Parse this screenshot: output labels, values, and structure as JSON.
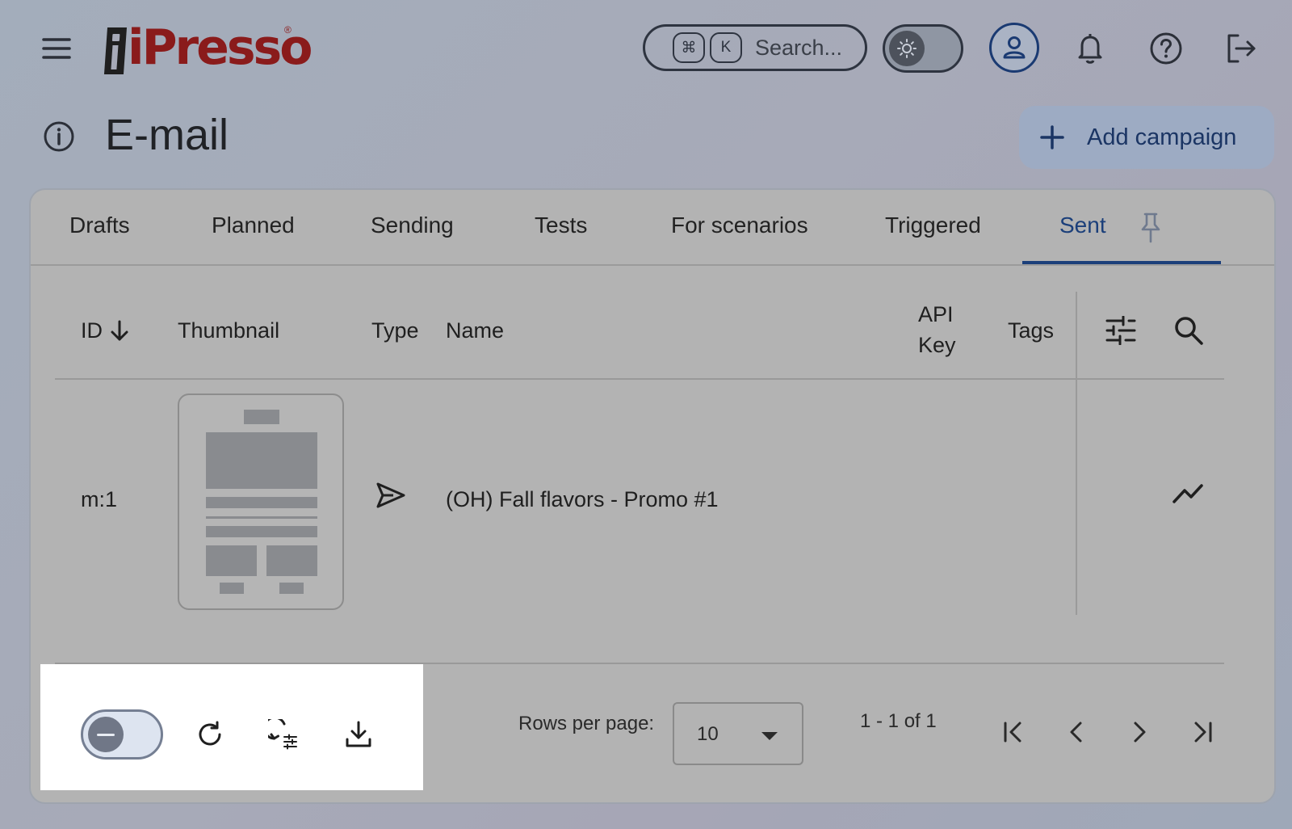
{
  "header": {
    "logo_text": "iPresso",
    "search": {
      "shortcut_mod": "⌘",
      "shortcut_key": "K",
      "placeholder": "Search..."
    }
  },
  "page": {
    "title": "E-mail",
    "add_button_label": "Add campaign"
  },
  "tabs": [
    {
      "label": "Drafts",
      "active": false
    },
    {
      "label": "Planned",
      "active": false
    },
    {
      "label": "Sending",
      "active": false
    },
    {
      "label": "Tests",
      "active": false
    },
    {
      "label": "For scenarios",
      "active": false
    },
    {
      "label": "Triggered",
      "active": false
    },
    {
      "label": "Sent",
      "active": true
    }
  ],
  "table": {
    "columns": {
      "id": "ID",
      "thumbnail": "Thumbnail",
      "type": "Type",
      "name": "Name",
      "api_key_line1": "API",
      "api_key_line2": "Key",
      "tags": "Tags"
    },
    "rows": [
      {
        "id": "m:1",
        "type_icon": "send-icon",
        "name": "(OH) Fall flavors - Promo #1",
        "action_icon": "stats-icon"
      }
    ]
  },
  "footer": {
    "rows_per_page_label": "Rows per page:",
    "rows_per_page_value": "10",
    "page_range": "1 - 1 of 1"
  },
  "colors": {
    "brand": "#8a1b1b",
    "accent": "#1b3f7a",
    "card_bg": "#b3b3b3",
    "highlight_panel": "#ffffff"
  }
}
